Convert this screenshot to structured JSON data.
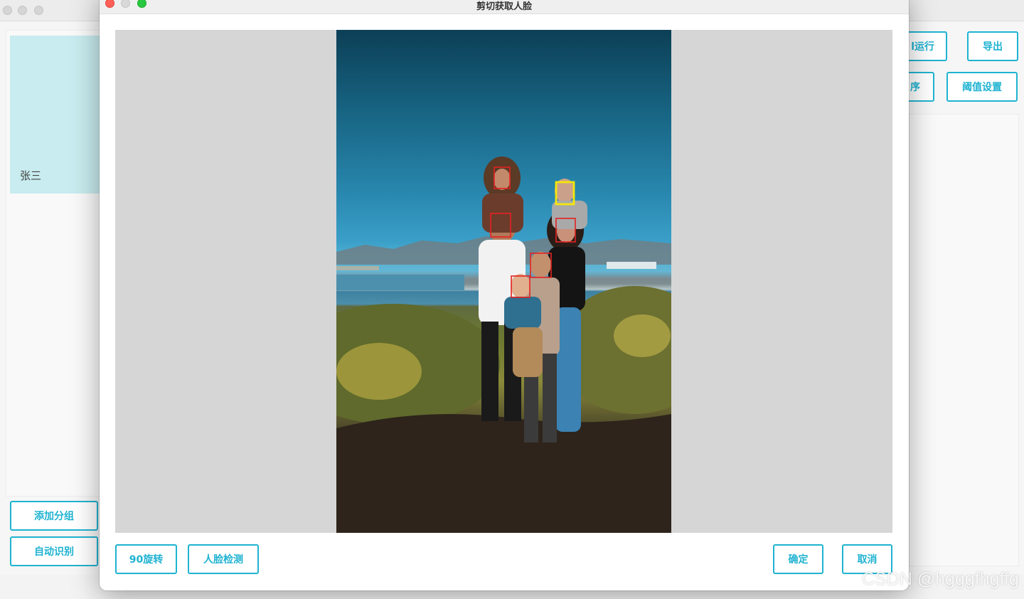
{
  "background": {
    "group": {
      "name": "张三"
    },
    "left_buttons": {
      "add_group": "添加分组",
      "auto_recognize": "自动识别"
    },
    "right_buttons": {
      "run_partial": "l运行",
      "export": "导出",
      "sort_partial": "序",
      "threshold": "阈值设置"
    }
  },
  "dialog": {
    "title": "剪切获取人脸",
    "buttons": {
      "rotate": "90旋转",
      "detect": "人脸检测",
      "confirm": "确定",
      "cancel": "取消"
    },
    "face_box_colors": {
      "normal": "#e52222",
      "selected": "#f5e60a"
    },
    "faces_detected": 7
  },
  "watermark": "CSDN @hgggfhgffg",
  "colors": {
    "accent": "#1fb3d1",
    "group_card": "#c8ecef"
  }
}
